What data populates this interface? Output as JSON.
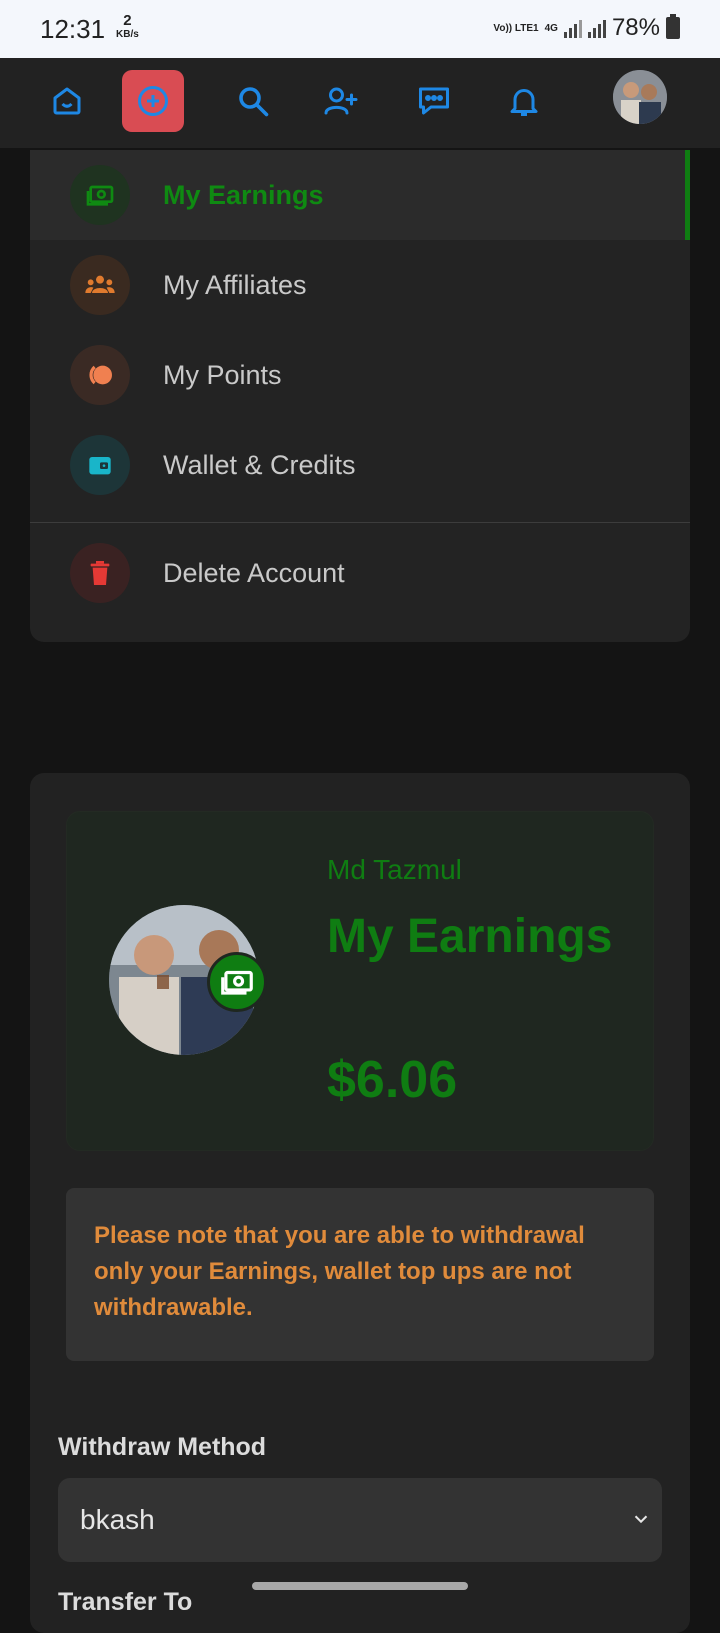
{
  "status_bar": {
    "time": "12:31",
    "data_rate_value": "2",
    "data_rate_unit": "KB/s",
    "network_volte": "Vo)) LTE1",
    "network_type": "4G",
    "battery_percent": "78%"
  },
  "top_nav": {
    "icons": [
      "home-icon",
      "add-circle-icon",
      "search-icon",
      "add-user-icon",
      "chat-icon",
      "bell-icon"
    ],
    "accent_color": "#1e88e5",
    "add_button_color": "#d94c53"
  },
  "menu": {
    "items": [
      {
        "label": "My Earnings",
        "icon": "money-icon",
        "active": true
      },
      {
        "label": "My Affiliates",
        "icon": "group-icon"
      },
      {
        "label": "My Points",
        "icon": "points-icon"
      },
      {
        "label": "Wallet & Credits",
        "icon": "wallet-icon"
      },
      {
        "label": "Delete Account",
        "icon": "trash-icon"
      }
    ],
    "active_color": "#0f8a12"
  },
  "earnings_card": {
    "user_name": "Md Tazmul",
    "title": "My Earnings",
    "amount": "$6.06"
  },
  "notice": {
    "text": "Please note that you are able to withdrawal only your Earnings, wallet top ups are not withdrawable."
  },
  "withdraw": {
    "method_label": "Withdraw Method",
    "method_value": "bkash",
    "next_label": "Transfer To"
  }
}
